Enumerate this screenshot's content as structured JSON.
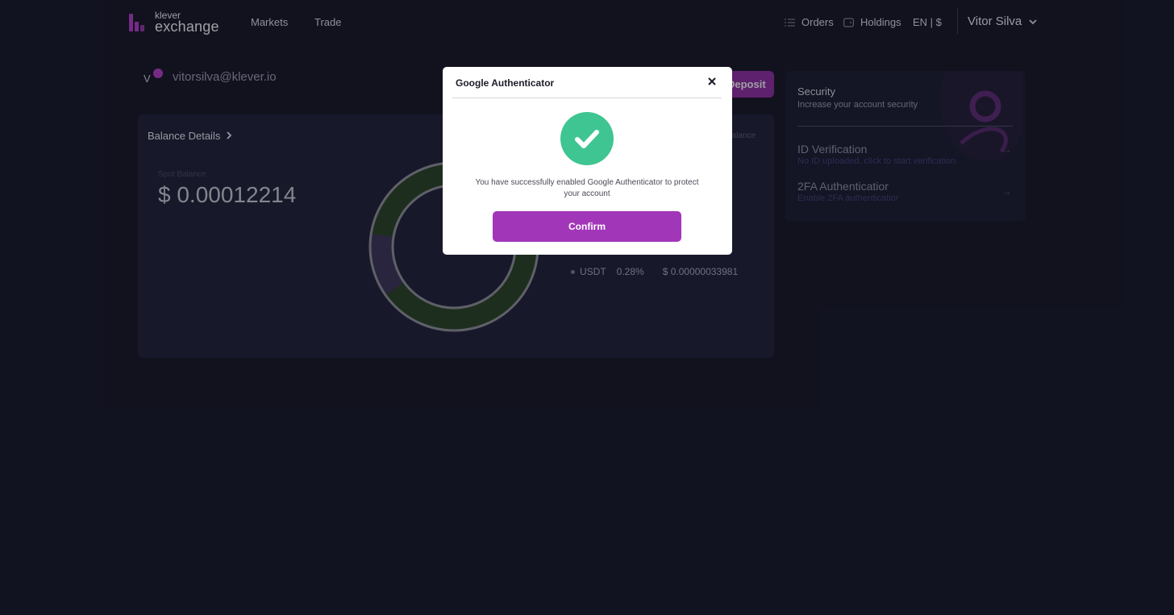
{
  "header": {
    "logo_small": "klever",
    "logo_big": "exchange",
    "nav": {
      "markets": "Markets",
      "trade": "Trade"
    },
    "orders": "Orders",
    "holdings": "Holdings",
    "lang_currency": "EN | $",
    "user_name": "Vitor Silva"
  },
  "account": {
    "avatar_letter": "V",
    "email": "vitorsilva@klever.io",
    "deposit_label": "Deposit"
  },
  "balance": {
    "title": "Balance Details",
    "spot_label": "Spot Balance",
    "spot_value": "$ 0.00012214",
    "right_label": "Balance",
    "legend": {
      "asset": "USDT",
      "percent": "0.28%",
      "value": "$ 0.00000033981"
    }
  },
  "chart_data": {
    "type": "pie",
    "categories": [
      "",
      "USDT"
    ],
    "values": [
      99.72,
      0.28
    ],
    "colors": [
      "#2a4325",
      "#3c3556"
    ]
  },
  "security": {
    "title": "Security",
    "subtitle": "Increase your account security",
    "items": [
      {
        "title": "ID Verification",
        "subtitle": "No ID uploaded, click to start verification."
      },
      {
        "title": "2FA Authenticatior",
        "subtitle": "Enable 2FA authenticatior"
      }
    ]
  },
  "modal": {
    "title": "Google Authenticator",
    "message": "You have successfully enabled Google Authenticator to protect your account",
    "confirm_label": "Confirm"
  },
  "colors": {
    "background": "#171827",
    "accent": "#a236b8",
    "success": "#3fc591"
  }
}
